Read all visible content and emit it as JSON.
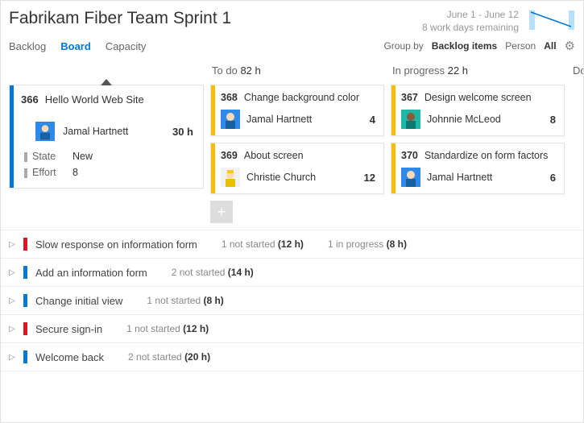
{
  "header": {
    "title": "Fabrikam Fiber Team Sprint 1",
    "dates": "June 1 - June 12",
    "remaining": "8 work days remaining"
  },
  "tabs": {
    "items": [
      "Backlog",
      "Board",
      "Capacity"
    ],
    "active": "Board"
  },
  "controls": {
    "group_label": "Group by",
    "group_value": "Backlog items",
    "person_label": "Person",
    "person_value": "All"
  },
  "columns": {
    "todo": {
      "label": "To do",
      "hours": "82 h"
    },
    "progress": {
      "label": "In progress",
      "hours": "22 h"
    },
    "done": {
      "label": "Done"
    }
  },
  "focus_card": {
    "id": "366",
    "title": "Hello World Web Site",
    "assignee": "Jamal Hartnett",
    "hours": "30 h",
    "state_label": "State",
    "state_value": "New",
    "effort_label": "Effort",
    "effort_value": "8"
  },
  "todo_cards": [
    {
      "id": "368",
      "title": "Change background color",
      "assignee": "Jamal Hartnett",
      "hours": "4",
      "avatar": "blue"
    },
    {
      "id": "369",
      "title": "About screen",
      "assignee": "Christie Church",
      "hours": "12",
      "avatar": "yellow"
    }
  ],
  "progress_cards": [
    {
      "id": "367",
      "title": "Design welcome screen",
      "assignee": "Johnnie McLeod",
      "hours": "8",
      "avatar": "teal"
    },
    {
      "id": "370",
      "title": "Standardize on form factors",
      "assignee": "Jamal Hartnett",
      "hours": "6",
      "avatar": "blue"
    }
  ],
  "backlog_rows": [
    {
      "color": "red",
      "title": "Slow response on information form",
      "stats": [
        {
          "text": "1 not started",
          "hours": "(12 h)"
        },
        {
          "text": "1 in progress",
          "hours": "(8 h)"
        }
      ]
    },
    {
      "color": "blue",
      "title": "Add an information form",
      "stats": [
        {
          "text": "2 not started",
          "hours": "(14 h)"
        }
      ]
    },
    {
      "color": "blue",
      "title": "Change initial view",
      "stats": [
        {
          "text": "1 not started",
          "hours": "(8 h)"
        }
      ]
    },
    {
      "color": "red",
      "title": "Secure sign-in",
      "stats": [
        {
          "text": "1 not started",
          "hours": "(12 h)"
        }
      ]
    },
    {
      "color": "blue",
      "title": "Welcome back",
      "stats": [
        {
          "text": "2 not started",
          "hours": "(20 h)"
        }
      ]
    }
  ]
}
